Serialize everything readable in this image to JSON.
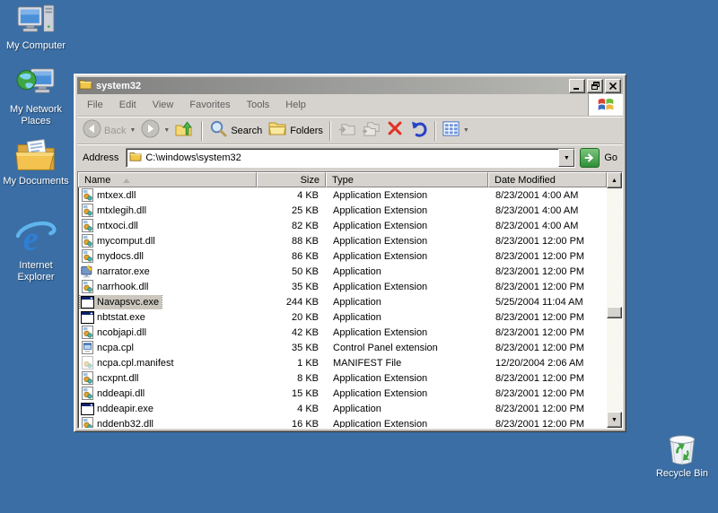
{
  "desktop": {
    "background_color": "#3A6EA5",
    "icons": [
      {
        "label": "My Computer",
        "icon": "my-computer-icon"
      },
      {
        "label": "My Network Places",
        "icon": "my-network-places-icon"
      },
      {
        "label": "My Documents",
        "icon": "my-documents-icon"
      },
      {
        "label": "Internet Explorer",
        "icon": "internet-explorer-icon"
      },
      {
        "label": "Recycle Bin",
        "icon": "recycle-bin-icon"
      }
    ]
  },
  "window": {
    "title": "system32",
    "title_icon": "folder-icon",
    "controls": [
      "minimize-icon",
      "restore-icon",
      "close-icon"
    ],
    "menu": {
      "items": [
        "File",
        "Edit",
        "View",
        "Favorites",
        "Tools",
        "Help"
      ]
    },
    "brand_icon": "windows-flag-icon",
    "toolbar": {
      "back_label": "Back",
      "search_label": "Search",
      "folders_label": "Folders",
      "icons": [
        "back-icon",
        "forward-icon",
        "up-folder-icon",
        "search-icon",
        "folders-icon",
        "move-to-icon",
        "copy-to-icon",
        "delete-icon",
        "undo-icon",
        "views-icon"
      ]
    },
    "address_bar": {
      "label": "Address",
      "value": "C:\\windows\\system32",
      "go_label": "Go"
    },
    "file_list": {
      "columns": [
        {
          "label": "Name",
          "sorted": "ascending"
        },
        {
          "label": "Size"
        },
        {
          "label": "Type"
        },
        {
          "label": "Date Modified"
        }
      ],
      "rows": [
        {
          "name": "mtxex.dll",
          "size": "4 KB",
          "type": "Application Extension",
          "date": "8/23/2001 4:00 AM",
          "icon": "dll-icon",
          "selected": false
        },
        {
          "name": "mtxlegih.dll",
          "size": "25 KB",
          "type": "Application Extension",
          "date": "8/23/2001 4:00 AM",
          "icon": "dll-icon",
          "selected": false
        },
        {
          "name": "mtxoci.dll",
          "size": "82 KB",
          "type": "Application Extension",
          "date": "8/23/2001 4:00 AM",
          "icon": "dll-icon",
          "selected": false
        },
        {
          "name": "mycomput.dll",
          "size": "88 KB",
          "type": "Application Extension",
          "date": "8/23/2001 12:00 PM",
          "icon": "dll-icon",
          "selected": false
        },
        {
          "name": "mydocs.dll",
          "size": "86 KB",
          "type": "Application Extension",
          "date": "8/23/2001 12:00 PM",
          "icon": "dll-icon",
          "selected": false
        },
        {
          "name": "narrator.exe",
          "size": "50 KB",
          "type": "Application",
          "date": "8/23/2001 12:00 PM",
          "icon": "narrator-icon",
          "selected": false
        },
        {
          "name": "narrhook.dll",
          "size": "35 KB",
          "type": "Application Extension",
          "date": "8/23/2001 12:00 PM",
          "icon": "dll-icon",
          "selected": false
        },
        {
          "name": "Navapsvc.exe",
          "size": "244 KB",
          "type": "Application",
          "date": "5/25/2004 11:04 AM",
          "icon": "app-icon",
          "selected": true
        },
        {
          "name": "nbtstat.exe",
          "size": "20 KB",
          "type": "Application",
          "date": "8/23/2001 12:00 PM",
          "icon": "app-icon",
          "selected": false
        },
        {
          "name": "ncobjapi.dll",
          "size": "42 KB",
          "type": "Application Extension",
          "date": "8/23/2001 12:00 PM",
          "icon": "dll-icon",
          "selected": false
        },
        {
          "name": "ncpa.cpl",
          "size": "35 KB",
          "type": "Control Panel extension",
          "date": "8/23/2001 12:00 PM",
          "icon": "cpl-icon",
          "selected": false
        },
        {
          "name": "ncpa.cpl.manifest",
          "size": "1 KB",
          "type": "MANIFEST File",
          "date": "12/20/2004 2:06 AM",
          "icon": "manifest-icon",
          "selected": false
        },
        {
          "name": "ncxpnt.dll",
          "size": "8 KB",
          "type": "Application Extension",
          "date": "8/23/2001 12:00 PM",
          "icon": "dll-icon",
          "selected": false
        },
        {
          "name": "nddeapi.dll",
          "size": "15 KB",
          "type": "Application Extension",
          "date": "8/23/2001 12:00 PM",
          "icon": "dll-icon",
          "selected": false
        },
        {
          "name": "nddeapir.exe",
          "size": "4 KB",
          "type": "Application",
          "date": "8/23/2001 12:00 PM",
          "icon": "app-icon",
          "selected": false
        },
        {
          "name": "nddenb32.dll",
          "size": "16 KB",
          "type": "Application Extension",
          "date": "8/23/2001 12:00 PM",
          "icon": "dll-icon",
          "selected": false
        }
      ]
    }
  }
}
